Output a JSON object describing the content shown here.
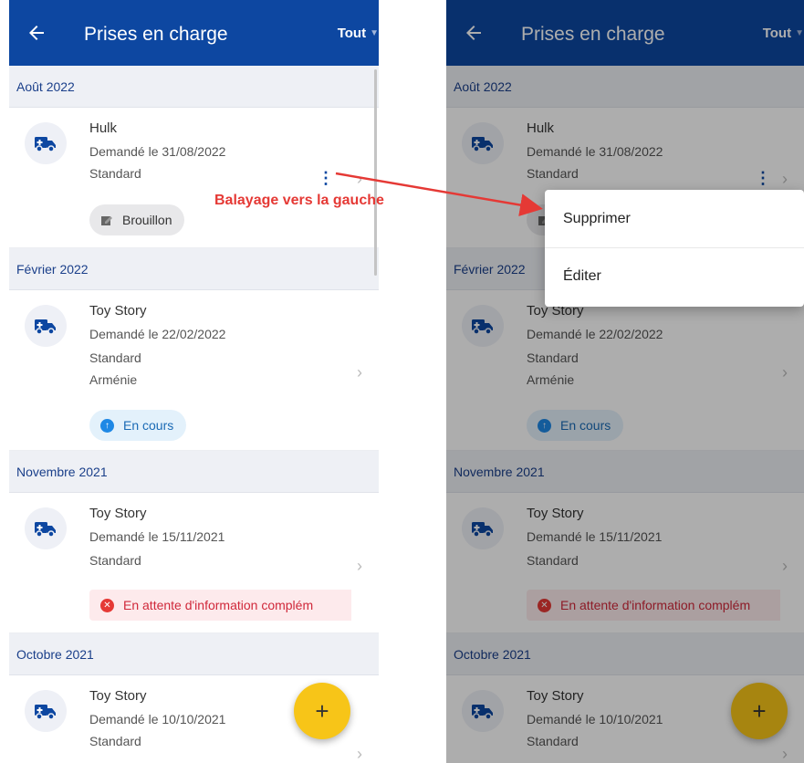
{
  "appbar": {
    "title": "Prises en charge",
    "filter_label": "Tout"
  },
  "colors": {
    "appbar": "#0d47a1",
    "accent_fab": "#f7c518",
    "annotation": "#e53935"
  },
  "months": [
    "Août 2022",
    "Février 2022",
    "Novembre 2021",
    "Octobre 2021"
  ],
  "items": [
    {
      "title": "Hulk",
      "requested": "Demandé le 31/08/2022",
      "type": "Standard",
      "country": "",
      "status": "Brouillon"
    },
    {
      "title": "Toy Story",
      "requested": "Demandé le 22/02/2022",
      "type": "Standard",
      "country": "Arménie",
      "status": "En cours"
    },
    {
      "title": "Toy Story",
      "requested": "Demandé le 15/11/2021",
      "type": "Standard",
      "country": "",
      "status": "En attente d'information complém"
    },
    {
      "title": "Toy Story",
      "requested": "Demandé le 10/10/2021",
      "type": "Standard",
      "country": "",
      "status": ""
    }
  ],
  "fab_label": "+",
  "context_menu": {
    "delete_label": "Supprimer",
    "edit_label": "Éditer"
  },
  "annotation": "Balayage vers la gauche",
  "icons": {
    "back": "arrow-left-icon",
    "item": "ambulance-icon",
    "menu": "kebab-icon",
    "chevron": "chevron-right-icon"
  }
}
